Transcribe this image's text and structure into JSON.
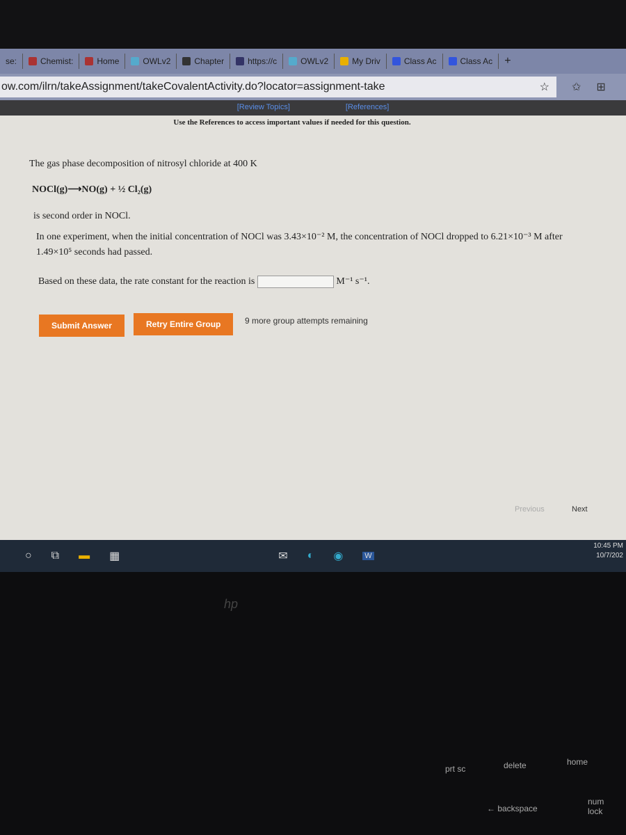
{
  "browser": {
    "tabs": [
      {
        "label": "se:"
      },
      {
        "label": "Chemist:",
        "icon": "book-icon"
      },
      {
        "label": "Home",
        "icon": "book-icon"
      },
      {
        "label": "OWLv2",
        "icon": "owl-icon"
      },
      {
        "label": "Chapter",
        "icon": "chapter-icon"
      },
      {
        "label": "https://c",
        "icon": "page-icon"
      },
      {
        "label": "OWLv2",
        "icon": "owl-icon"
      },
      {
        "label": "My Driv",
        "icon": "drive-icon"
      },
      {
        "label": "Class Ac",
        "icon": "doc-icon"
      },
      {
        "label": "Class Ac",
        "icon": "doc-icon"
      }
    ],
    "new_tab": "+",
    "url": "ow.com/ilrn/takeAssignment/takeCovalentActivity.do?locator=assignment-take"
  },
  "refbar": {
    "review": "[Review Topics]",
    "references": "[References]"
  },
  "question": {
    "note": "Use the References to access important values if needed for this question.",
    "intro": "The gas phase decomposition of nitrosyl chloride at 400 K",
    "equation": "NOCl(g)⟶NO(g) + ½ Cl₂(g)",
    "order": "is second order in NOCl.",
    "experiment": "In one experiment, when the initial concentration of NOCl was 3.43×10⁻² M, the concentration of NOCl dropped to 6.21×10⁻³ M after 1.49×10⁵ seconds had passed.",
    "prompt": "Based on these data, the rate constant for the reaction is",
    "answer": "",
    "units": "M⁻¹ s⁻¹."
  },
  "actions": {
    "submit": "Submit Answer",
    "retry": "Retry Entire Group",
    "attempts": "9 more group attempts remaining",
    "previous": "Previous",
    "next": "Next"
  },
  "taskbar": {
    "time": "10:45 PM",
    "date": "10/7/202"
  },
  "keyboard": {
    "prtsc": "prt sc",
    "delete": "delete",
    "home": "home",
    "backspace": "← backspace",
    "numlock": "num lock",
    "brand": "hp"
  },
  "colors": {
    "accent": "#e87722",
    "link": "#5a8ee8"
  }
}
